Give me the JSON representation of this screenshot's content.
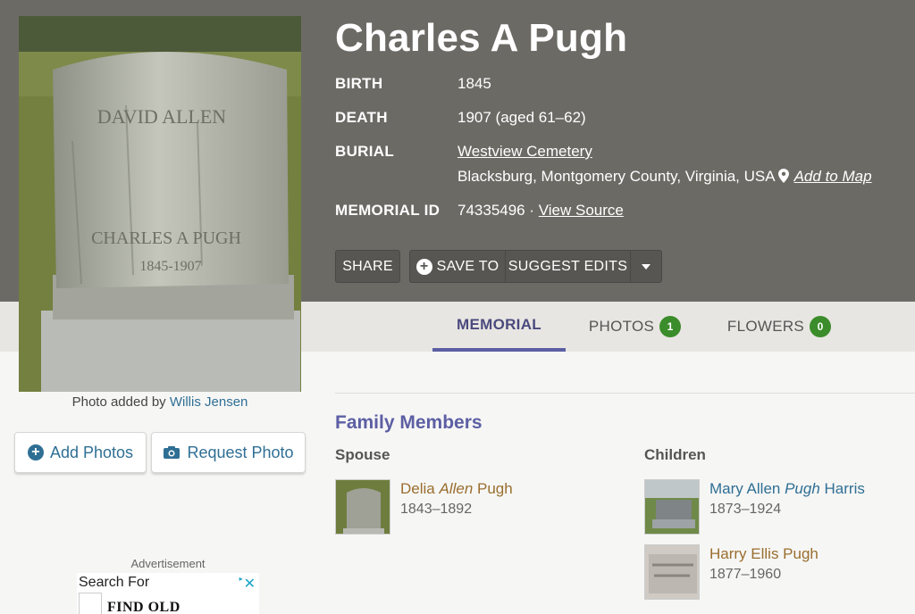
{
  "memorial": {
    "name": "Charles A Pugh",
    "birth_label": "BIRTH",
    "birth_value": "1845",
    "death_label": "DEATH",
    "death_value": "1907 (aged 61–62)",
    "burial_label": "BURIAL",
    "cemetery": "Westview Cemetery",
    "location": "Blacksburg, Montgomery County, Virginia, USA",
    "add_to_map": "Add to Map",
    "memorial_id_label": "MEMORIAL ID",
    "memorial_id": "74335496",
    "id_separator": " · ",
    "view_source": "View Source"
  },
  "actions": {
    "share": "SHARE",
    "save_to": "SAVE TO",
    "suggest_edits": "SUGGEST EDITS"
  },
  "photo": {
    "caption_prefix": "Photo added by ",
    "contributor": "Willis Jensen",
    "add_photos": "Add Photos",
    "request_photo": "Request Photo",
    "headstone_text": [
      "DAVID ALLEN",
      "CHARLES A PUGH",
      "1845-1907"
    ]
  },
  "tabs": [
    {
      "label": "MEMORIAL"
    },
    {
      "label": "PHOTOS",
      "count": "1"
    },
    {
      "label": "FLOWERS",
      "count": "0"
    }
  ],
  "family": {
    "title": "Family Members",
    "spouse_heading": "Spouse",
    "children_heading": "Children",
    "spouse": {
      "first": "Delia ",
      "maiden": "Allen",
      "last": " Pugh",
      "dates": "1843–1892"
    },
    "children": [
      {
        "first": "Mary Allen ",
        "maiden": "Pugh",
        "last": " Harris",
        "dates": "1873–1924"
      },
      {
        "first": "Harry Ellis Pugh",
        "maiden": "",
        "last": "",
        "dates": "1877–1960"
      }
    ]
  },
  "ad": {
    "label": "Advertisement",
    "search_for": "Search For",
    "find_old": "FIND OLD"
  },
  "colors": {
    "hero_bg": "#6c6a65",
    "accent": "#5c5fa3",
    "link_blue": "#2f6f94",
    "link_brown": "#9a6e2e",
    "badge_green": "#3b8c2a"
  },
  "icons": [
    "plus-circle-icon",
    "camera-icon",
    "map-pin-icon",
    "caret-down-icon",
    "close-icon",
    "ad-choices-icon"
  ]
}
